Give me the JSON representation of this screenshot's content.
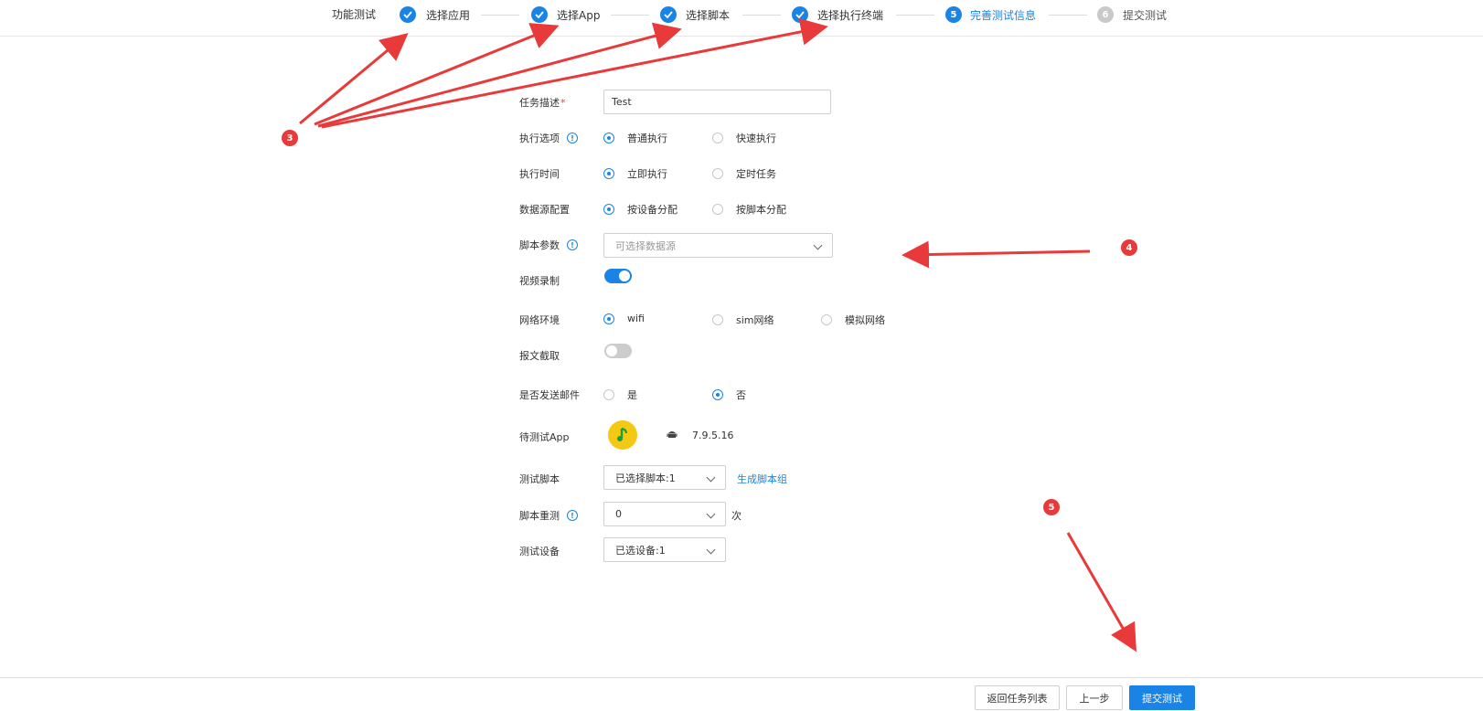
{
  "steps": {
    "title": "功能测试",
    "items": [
      {
        "label": "选择应用",
        "state": "done",
        "num": ""
      },
      {
        "label": "选择App",
        "state": "done",
        "num": ""
      },
      {
        "label": "选择脚本",
        "state": "done",
        "num": ""
      },
      {
        "label": "选择执行终端",
        "state": "done",
        "num": ""
      },
      {
        "label": "完善测试信息",
        "state": "active",
        "num": "5"
      },
      {
        "label": "提交测试",
        "state": "todo",
        "num": "6"
      }
    ]
  },
  "form": {
    "task_desc": {
      "label": "任务描述",
      "required_mark": "*",
      "value": "Test"
    },
    "exec_option": {
      "label": "执行选项",
      "options": [
        "普通执行",
        "快速执行"
      ],
      "selected": "普通执行"
    },
    "exec_time": {
      "label": "执行时间",
      "options": [
        "立即执行",
        "定时任务"
      ],
      "selected": "立即执行"
    },
    "datasource": {
      "label": "数据源配置",
      "options": [
        "按设备分配",
        "按脚本分配"
      ],
      "selected": "按设备分配"
    },
    "script_params": {
      "label": "脚本参数",
      "placeholder": "可选择数据源"
    },
    "video": {
      "label": "视频录制",
      "on": true
    },
    "network": {
      "label": "网络环境",
      "options": [
        "wifi",
        "sim网络",
        "模拟网络"
      ],
      "selected": "wifi"
    },
    "packet": {
      "label": "报文截取",
      "on": false
    },
    "email": {
      "label": "是否发送邮件",
      "options": [
        "是",
        "否"
      ],
      "selected": "否"
    },
    "app": {
      "label": "待测试App",
      "version": "7.9.5.16",
      "icon": "music-app-icon"
    },
    "script": {
      "label": "测试脚本",
      "value": "已选择脚本:1",
      "link": "生成脚本组"
    },
    "retry": {
      "label": "脚本重测",
      "value": "0",
      "unit": "次"
    },
    "device": {
      "label": "测试设备",
      "value": "已选设备:1"
    }
  },
  "footer": {
    "back_list": "返回任务列表",
    "prev": "上一步",
    "submit": "提交测试"
  },
  "annotations": {
    "badge3": "3",
    "badge4": "4",
    "badge5": "5"
  },
  "colors": {
    "primary": "#1a84e6",
    "annotation": "#e83a3a"
  }
}
